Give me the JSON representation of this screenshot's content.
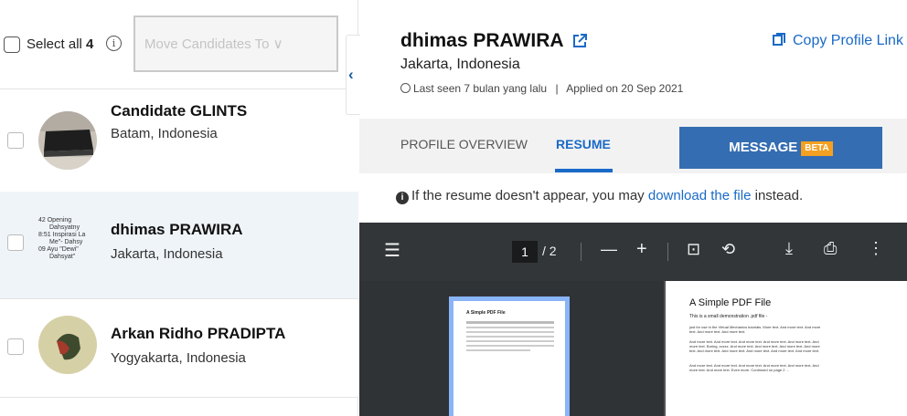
{
  "toolbar": {
    "select_all_label": "Select all",
    "select_all_count": "4",
    "info_glyph": "i",
    "move_placeholder": "Move Candidates To ∨"
  },
  "candidates": [
    {
      "name": "Candidate GLINTS",
      "location": "Batam, Indonesia",
      "active": false
    },
    {
      "name": "dhimas PRAWIRA",
      "location": "Jakarta, Indonesia",
      "active": true
    },
    {
      "name": "Arkan Ridho PRADIPTA",
      "location": "Yogyakarta, Indonesia",
      "active": false
    }
  ],
  "avatar_text": {
    "lines": [
      "42  Opening",
      "Dahsyatny",
      "8:51 Inspirasi La",
      "Me\"- Dahsy",
      "09  Ayu \"Dewi\"",
      "Dahsyat\""
    ]
  },
  "collapse_glyph": "‹",
  "profile": {
    "name": "dhimas PRAWIRA",
    "location": "Jakarta, Indonesia",
    "last_seen": "Last seen 7 bulan yang lalu",
    "divider": "|",
    "applied": "Applied on 20 Sep 2021",
    "copy_link": "Copy Profile Link"
  },
  "tabs": {
    "overview": "PROFILE OVERVIEW",
    "resume": "RESUME",
    "message": "MESSAGE",
    "beta": "BETA"
  },
  "notice": {
    "icon": "i",
    "before": "If the resume doesn't appear, you may",
    "link": "download the file",
    "after": "instead."
  },
  "pdf": {
    "menu_icon": "☰",
    "page_current": "1",
    "page_total": "/ 2",
    "zoom_out": "—",
    "zoom_in": "+",
    "fit_icon": "⊡",
    "rotate_icon": "⟲",
    "download_icon": "⤓",
    "print_icon": "⎙",
    "more_icon": "⋮",
    "thumb_title": "A Simple PDF File",
    "page_title": "A Simple PDF File",
    "page_subtitle": "This is a small demonstration .pdf file -",
    "page_paragraphs": [
      "just for use in the Virtual Mechanics tutorials. More text. And more text. And more text. And more text. And more text.",
      "And more text. And more text. And more text. And more text. And more text. And more text. Boring, zzzzz. And more text. And more text. And more text. And more text. And more text. And more text. And more text. And more text. And more text.",
      "And more text. And more text. And more text. And more text. And more text. And more text. And more text. Even more. Continued on page 2 ..."
    ]
  }
}
